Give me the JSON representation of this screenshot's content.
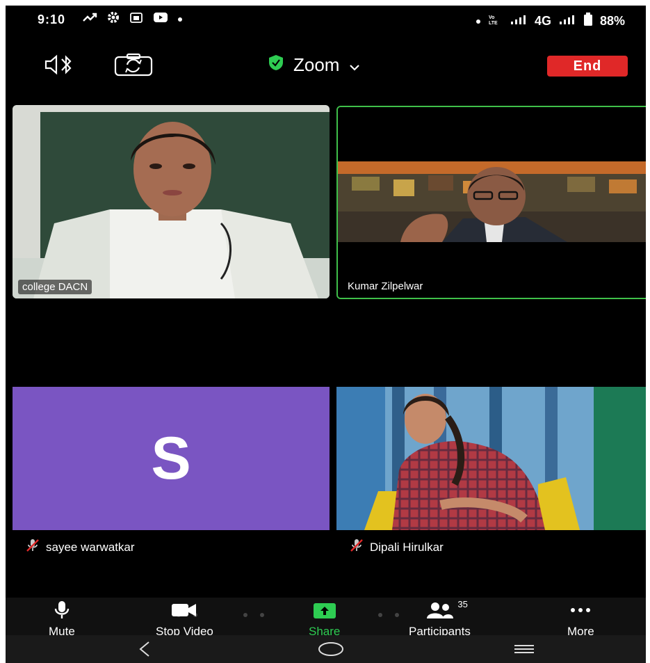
{
  "status_bar": {
    "time": "9:10",
    "network": "4G",
    "battery": "88%"
  },
  "top_bar": {
    "meeting_title": "Zoom",
    "end_label": "End"
  },
  "participants": [
    {
      "name": "college DACN",
      "video": true
    },
    {
      "name": "Kumar Zilpelwar",
      "video": true,
      "active_speaker": true
    },
    {
      "name": "sayee warwatkar",
      "video": false,
      "avatar_letter": "S",
      "muted": true
    },
    {
      "name": "Dipali Hirulkar",
      "video": true,
      "muted": true
    }
  ],
  "toolbar": {
    "mute": "Mute",
    "stop_video": "Stop Video",
    "share": "Share",
    "participants": "Participants",
    "participants_count": "35",
    "more": "More"
  },
  "colors": {
    "end": "#e02828",
    "share": "#2ecc52",
    "active_border": "#3fc04a",
    "avatar_bg": "#7a55c2"
  }
}
